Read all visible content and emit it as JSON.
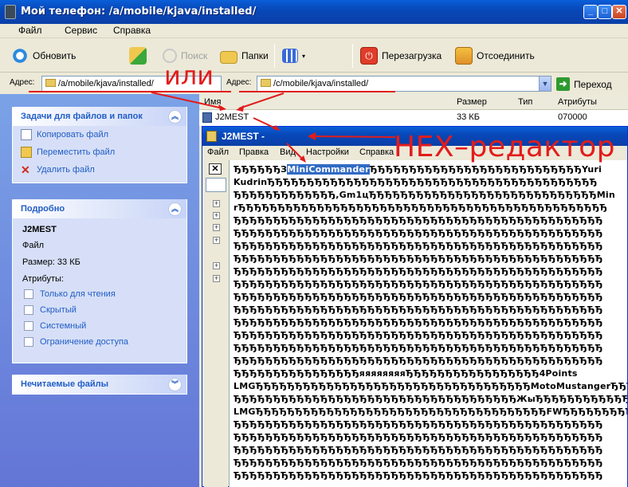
{
  "window": {
    "title": "Мой телефон: /a/mobile/kjava/installed/"
  },
  "menu": {
    "file": "Файл",
    "service": "Сервис",
    "help": "Справка"
  },
  "toolbar": {
    "refresh": "Обновить",
    "search": "Поиск",
    "folders": "Папки",
    "restart": "Перезагрузка",
    "disconnect": "Отсоединить"
  },
  "address": {
    "label1": "Адрес:",
    "value1": "/a/mobile/kjava/installed/",
    "label2": "Адрес:",
    "value2": "/c/mobile/kjava/installed/",
    "go": "Переход"
  },
  "tasks": {
    "header": "Задачи для файлов и папок",
    "items": [
      "Копировать файл",
      "Переместить файл",
      "Удалить файл"
    ]
  },
  "details": {
    "header": "Подробно",
    "name": "J2MEST",
    "type": "Файл",
    "size": "Размер: 33 КБ",
    "attrs_label": "Атрибуты:",
    "attrs": [
      "Только для чтения",
      "Скрытый",
      "Системный",
      "Ограничение доступа"
    ]
  },
  "unreadable": {
    "header": "Нечитаемые файлы"
  },
  "filelist": {
    "columns": [
      "Имя",
      "Размер",
      "Тип",
      "Атрибуты"
    ],
    "row": {
      "name": "J2MEST",
      "size": "33 КБ",
      "type": "",
      "attrs": "070000"
    }
  },
  "inner_window": {
    "title": "J2MEST -",
    "menu": [
      "Файл",
      "Правка",
      "Вид",
      "Настройки",
      "Справка"
    ],
    "close_btn": "✕"
  },
  "hex_lines": [
    "ЂЂЂЂЂЂЗ",
    "MiniCommander",
    "ЂЂЂЂЂЂЂЂЂЂЂЂЂЂЂЂЂЂЂЂЂЂЂЂЂЂЂYuri",
    "KudrinЂЂЂЂЂЂЂЂЂЂЂЂЂЂЂЂЂЂЂЂЂЂЂЂЂЂЂЂЂЂЂЂЂЂЂЂЂЂЂЂЂЂ",
    "ЂЂЂЂЂЂЂЂЂЂЂЂЂ,Gm1цЂЂЂЂЂЂЂЂЂЂЂЂЂЂЂЂЂЂЂЂЂЂЂЂЂЂЂЂЂMin",
    "rЂЂЂЂЂЂЂЂЂЂЂЂЂЂЂЂЂЂЂЂЂЂЂЂЂЂЂЂЂЂЂЂЂЂЂЂЂЂЂЂЂЂЂЂЂЂЂ",
    "ЂЂЂЂЂЂЂЂЂЂЂЂЂЂЂЂЂЂЂЂЂЂЂЂЂЂЂЂЂЂЂЂЂЂЂЂЂЂЂЂЂЂЂЂЂЂЂ",
    "ЂЂЂЂЂЂЂЂЂЂЂЂЂЂЂЂЂЂЂЂЂЂЂЂЂЂЂЂЂЂЂЂЂЂЂЂЂЂЂЂЂЂЂЂЂЂЂ",
    "ЂЂЂЂЂЂЂЂЂЂЂЂЂЂЂЂЂЂЂЂЂЂЂЂЂЂЂЂЂЂЂЂЂЂЂЂЂЂЂЂЂЂЂЂЂЂЂ",
    "ЂЂЂЂЂЂЂЂЂЂЂЂЂЂЂЂЂЂЂЂЂЂЂЂЂЂЂЂЂЂЂЂЂЂЂЂЂЂЂЂЂЂЂЂЂЂЂ",
    "ЂЂЂЂЂЂЂЂЂЂЂЂЂЂЂЂЂЂЂЂЂЂЂЂЂЂЂЂЂЂЂЂЂЂЂЂЂЂЂЂЂЂЂЂЂЂЂ",
    "ЂЂЂЂЂЂЂЂЂЂЂЂЂЂЂЂЂЂЂЂЂЂЂЂЂЂЂЂЂЂЂЂЂЂЂЂЂЂЂЂЂЂЂЂЂЂЂ",
    "ЂЂЂЂЂЂЂЂЂЂЂЂЂЂЂЂЂЂЂЂЂЂЂЂЂЂЂЂЂЂЂЂЂЂЂЂЂЂЂЂЂЂЂЂЂЂЂ",
    "ЂЂЂЂЂЂЂЂЂЂЂЂЂЂЂЂЂЂЂЂЂЂЂЂЂЂЂЂЂЂЂЂЂЂЂЂЂЂЂЂЂЂЂЂЂЂЂ",
    "ЂЂЂЂЂЂЂЂЂЂЂЂЂЂЂЂЂЂЂЂЂЂЂЂЂЂЂЂЂЂЂЂЂЂЂЂЂЂЂЂЂЂЂЂЂЂЂ",
    "ЂЂЂЂЂЂЂЂЂЂЂЂЂЂЂЂЂЂЂЂЂЂЂЂЂЂЂЂЂЂЂЂЂЂЂЂЂЂЂЂЂЂЂЂЂЂЂ",
    "ЂЂЂЂЂЂЂЂЂЂЂЂЂЂЂЂЂЂЂЂЂЂЂЂЂЂЂЂЂЂЂЂЂЂЂЂЂЂЂЂЂЂЂЂЂЂЂ",
    "ЂЂЂЂЂЂЂЂЂЂЂЂЂЂЂЂЂЂЂЂЂЂЂЂЂЂЂЂЂЂЂЂЂЂЂЂЂЂЂЂЂЂЂЂЂЂЂ",
    "ЂЂЂЂЂЂЂЂЂЂЂЂЂЂЂЂяяяяяяяяЂЂЂЂЂЂЂЂЂЂЂЂЂЂЂЂЂ4Points",
    "LMGЂЂЂЂЂЂЂЂЂЂЂЂЂЂЂЂЂЂЂЂЂЂЂЂЂЂЂЂЂЂЂЂЂЂЂMotoMustangerЂЂЂЂ",
    "ЂЂЂЂЂЂЂЂЂЂЂЂЂЂЂЂЂЂЂЂЂЂЂЂЂЂЂЂЂЂЂЂЂЂЂЂЖыЂЂЂЂЂЂЂЂЂЂЂЂЂЂ",
    "LMGЂЂЂЂЂЂЂЂЂЂЂЂЂЂЂЂЂЂЂЂЂЂЂЂЂЂЂЂЂЂЂЂЂЂЂЂЂFWЂЂЂЂЂЂЂЂЂЂ",
    "ЂЂЂЂЂЂЂЂЂЂЂЂЂЂЂЂЂЂЂЂЂЂЂЂЂЂЂЂЂЂЂЂЂЂЂЂЂЂЂЂЂЂЂЂЂЂЂ",
    "ЂЂЂЂЂЂЂЂЂЂЂЂЂЂЂЂЂЂЂЂЂЂЂЂЂЂЂЂЂЂЂЂЂЂЂЂЂЂЂЂЂЂЂЂЂЂЂ",
    "ЂЂЂЂЂЂЂЂЂЂЂЂЂЂЂЂЂЂЂЂЂЂЂЂЂЂЂЂЂЂЂЂЂЂЂЂЂЂЂЂЂЂЂЂЂЂЂ",
    "ЂЂЂЂЂЂЂЂЂЂЂЂЂЂЂЂЂЂЂЂЂЂЂЂЂЂЂЂЂЂЂЂЂЂЂЂЂЂЂЂЂЂЂЂЂЂЂ",
    "ЂЂЂЂЂЂЂЂЂЂЂЂЂЂЂЂЂЂЂЂЂЂЂЂЂЂЂЂЂЂЂЂЂЂЂЂЂЂЂЂЂЂЂЂЂЂЂ"
  ],
  "annotations": {
    "or": "или",
    "hex_editor": "HEX–редактор"
  },
  "colors": {
    "accent": "#215dc6",
    "annotation": "#e21c1c",
    "selection": "#316ac5"
  }
}
